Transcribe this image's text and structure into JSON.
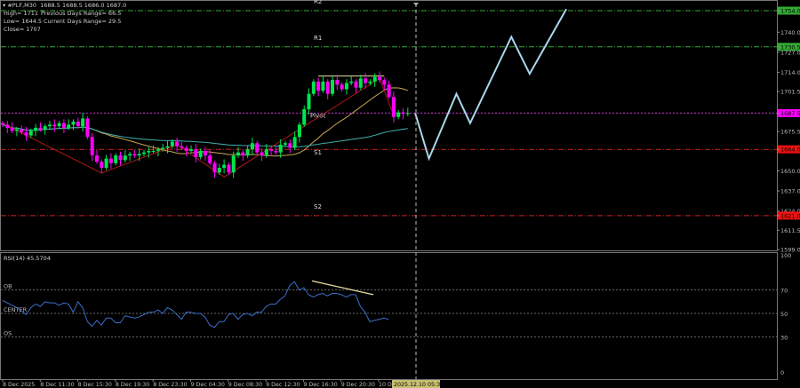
{
  "header": {
    "symbol_line": "#PLF,M30  1688.5 1688.5 1686.0 1687.0",
    "high": "High= 1711",
    "prev_range": "Previous Days Range= 66.5",
    "low": "Low= 1644.5",
    "curr_range": "Current Days Range= 29.5",
    "close": "Close= 1707"
  },
  "colors": {
    "bull": "#00e64d",
    "bear": "#ff00ff",
    "pivot": "#cc33cc",
    "resistance": "#33aa33",
    "support": "#cc2222",
    "ma_fast": "#c8a850",
    "ma_slow": "#40b0b0",
    "zigzag": "#aa1a1a",
    "projection": "#a8d8ec",
    "rsi": "#3a6ec8"
  },
  "chart_data": [
    {
      "type": "candlestick",
      "symbol": "#PLF",
      "timeframe": "M30",
      "ylim": [
        1599.0,
        1754.0
      ],
      "y_ticks": [
        "1754.0",
        "1740.0",
        "1730.5",
        "1727.0",
        "1714.0",
        "1701.5",
        "1687.5",
        "1675.5",
        "1664.0",
        "1650.0",
        "1637.0",
        "1624.0",
        "1621.0",
        "1611.5",
        "1599.0"
      ],
      "x_ticks": [
        "8 Dec 2025",
        "8 Dec 11:30",
        "8 Dec 15:30",
        "8 Dec 19:30",
        "8 Dec 23:30",
        "9 Dec 04:30",
        "9 Dec 08:30",
        "9 Dec 12:30",
        "9 Dec 16:30",
        "9 Dec 20:30",
        "10 Dec"
      ],
      "cursor_time": "2025.12.10 05:30",
      "closes": [
        1680,
        1678,
        1676,
        1677,
        1675,
        1673,
        1676,
        1678,
        1677,
        1679,
        1680,
        1679,
        1681,
        1678,
        1680,
        1682,
        1679,
        1684,
        1672,
        1660,
        1656,
        1652,
        1658,
        1655,
        1660,
        1657,
        1660,
        1661,
        1660,
        1661,
        1662,
        1663,
        1663,
        1664,
        1665,
        1666,
        1669,
        1666,
        1665,
        1663,
        1664,
        1659,
        1663,
        1660,
        1655,
        1649,
        1652,
        1654,
        1649,
        1660,
        1662,
        1660,
        1664,
        1668,
        1662,
        1660,
        1664,
        1663,
        1662,
        1667,
        1668,
        1665,
        1672,
        1680,
        1690,
        1700,
        1708,
        1702,
        1708,
        1700,
        1709,
        1706,
        1703,
        1707,
        1708,
        1704,
        1710,
        1707,
        1708,
        1711,
        1709,
        1706,
        1698,
        1685,
        1688,
        1687,
        1687.5
      ],
      "levels": [
        {
          "label": "R2",
          "price": 1754.0,
          "kind": "resistance"
        },
        {
          "label": "R1",
          "price": 1730.5,
          "kind": "resistance"
        },
        {
          "label": "Pivot",
          "price": 1687.5,
          "kind": "pivot"
        },
        {
          "label": "S1",
          "price": 1664.0,
          "kind": "support"
        },
        {
          "label": "S2",
          "price": 1621.0,
          "kind": "support"
        }
      ],
      "zigzag": [
        [
          0,
          1680.7
        ],
        [
          21,
          1648.6
        ],
        [
          37,
          1667
        ],
        [
          47,
          1646
        ],
        [
          80,
          1710
        ],
        [
          83,
          1686
        ]
      ],
      "resistance_line": {
        "from": [
          67,
          1711
        ],
        "to": [
          81,
          1711
        ]
      },
      "projection": [
        [
          1687,
          1687.5
        ],
        [
          1690,
          1658
        ],
        [
          1696,
          1700
        ],
        [
          1699,
          1681
        ],
        [
          1708,
          1737
        ],
        [
          1712,
          1713
        ],
        [
          1720,
          1755
        ]
      ]
    },
    {
      "type": "line",
      "title": "RSI(14) 45.5704",
      "ylim": [
        0,
        100
      ],
      "y_ticks": [
        "100",
        "70",
        "50",
        "30",
        "0"
      ],
      "levels": [
        {
          "label": "OB",
          "value": 70
        },
        {
          "label": "CENTER",
          "value": 50
        },
        {
          "label": "OS",
          "value": 30
        }
      ],
      "values": [
        61,
        59,
        57,
        55,
        52,
        49,
        55,
        58,
        56,
        60,
        59,
        59,
        57,
        59,
        58,
        51,
        60,
        55,
        43,
        39,
        44,
        40,
        46,
        46,
        42,
        42,
        48,
        47,
        46,
        47,
        49,
        51,
        51,
        53,
        50,
        55,
        53,
        49,
        45,
        51,
        51,
        50,
        50,
        47,
        40,
        38,
        43,
        43,
        49,
        50,
        45,
        49,
        50,
        48,
        51,
        51,
        56,
        58,
        58,
        62,
        65,
        74,
        77,
        70,
        72,
        66,
        64,
        66,
        67,
        65,
        67,
        67,
        66,
        64,
        66,
        66,
        56,
        51,
        43,
        44,
        45,
        46,
        45
      ]
    }
  ]
}
